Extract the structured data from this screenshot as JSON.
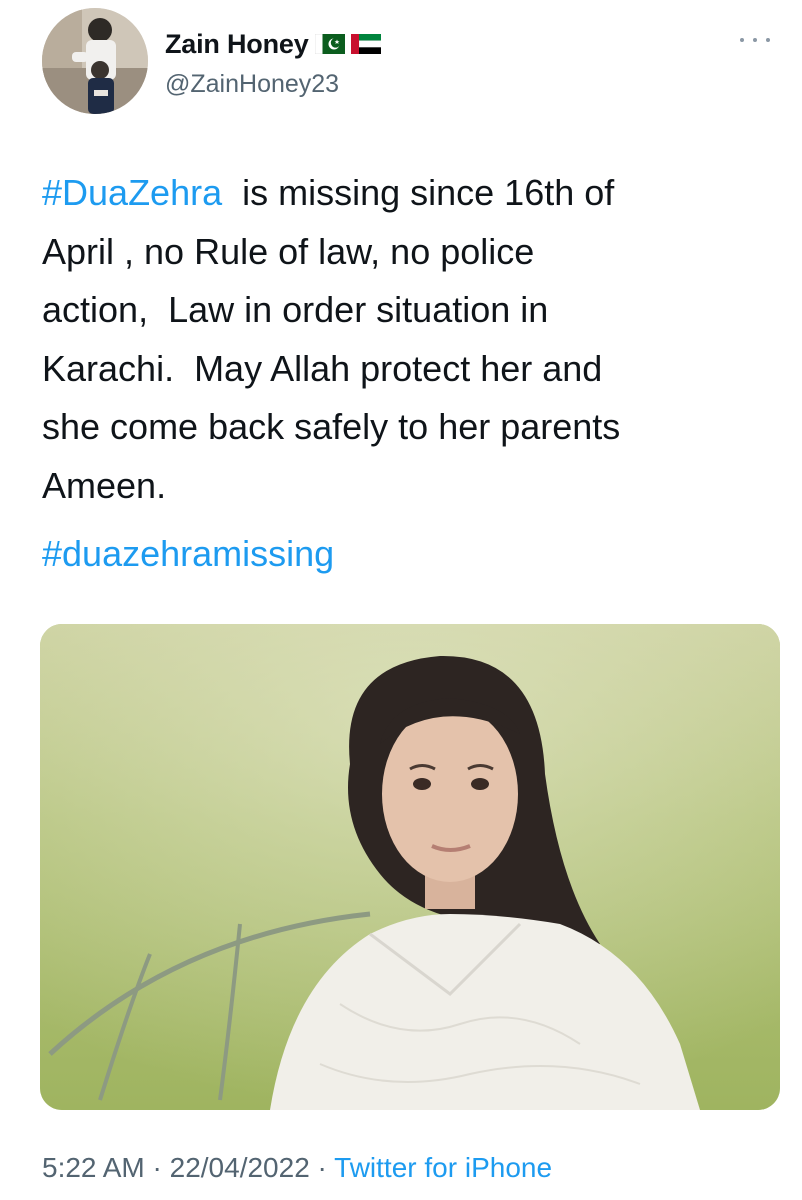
{
  "author": {
    "display_name": "Zain Honey",
    "handle": "@ZainHoney23",
    "flags": [
      "pakistan-flag-icon",
      "uae-flag-icon"
    ]
  },
  "tweet": {
    "lines": [
      {
        "hashtag": "#DuaZehra",
        "text": "  is missing since 16th of"
      },
      {
        "text": "April , no Rule of law, no police"
      },
      {
        "text": "action,  Law in order situation in"
      },
      {
        "text": "Karachi.  May Allah protect her and"
      },
      {
        "text": "she come back safely to her parents"
      },
      {
        "text": "Ameen."
      }
    ],
    "hashtag_line": "#duazehramissing"
  },
  "meta": {
    "time": "5:22 AM",
    "separator": "·",
    "date": "22/04/2022",
    "source": "Twitter for iPhone"
  },
  "icons": {
    "more": "more-options-icon"
  },
  "colors": {
    "link": "#1d9bf0",
    "text": "#0f1419",
    "secondary": "#536471"
  }
}
